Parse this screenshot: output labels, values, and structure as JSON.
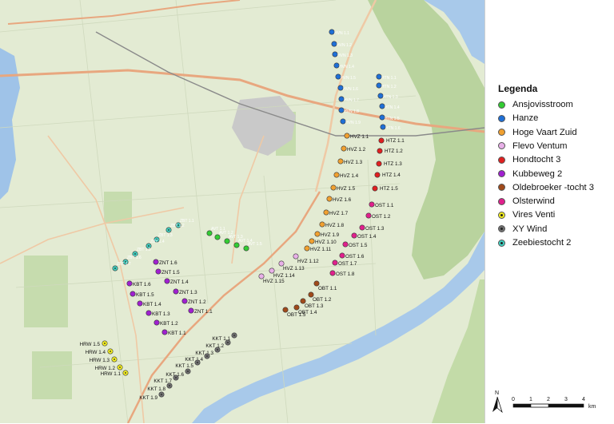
{
  "legend": {
    "title": "Legenda",
    "items": [
      {
        "label": "Ansjovisstroom",
        "color": "#33cc33",
        "center": false
      },
      {
        "label": "Hanze",
        "color": "#1f6fd6",
        "center": false
      },
      {
        "label": "Hoge Vaart Zuid",
        "color": "#f0a030",
        "center": false
      },
      {
        "label": "Flevo Ventum",
        "color": "#e8b0e8",
        "center": false
      },
      {
        "label": "Hondtocht 3",
        "color": "#e02020",
        "center": false
      },
      {
        "label": "Kubbeweg 2",
        "color": "#a020d0",
        "center": false
      },
      {
        "label": "Oldebroeker -tocht 3",
        "color": "#a04a1a",
        "center": false
      },
      {
        "label": "Olsterwind",
        "color": "#e0208c",
        "center": false
      },
      {
        "label": "Vires Venti",
        "color": "#f5f020",
        "center": true
      },
      {
        "label": "XY Wind",
        "color": "#707070",
        "center": true
      },
      {
        "label": "Zeebiestocht 2",
        "color": "#40d0c0",
        "center": true
      }
    ]
  },
  "scale": {
    "ticks": [
      "0",
      "1",
      "2",
      "3",
      "4"
    ],
    "unit": "km",
    "north": "N"
  },
  "turbines": [
    {
      "group": "Hanze",
      "color": "#1f6fd6",
      "center": false,
      "labelcolor": "#ffffff",
      "labels": [
        "HVN 1.1",
        "HVN 1.2",
        "HVN 1.3",
        "HVN 1.4",
        "HVN 1.5",
        "HVN 1.6",
        "HVN 1.7",
        "HVN 1.8",
        "HVN 1.9",
        "HTN 1.1",
        "HTN 1.2",
        "HTN 1.3",
        "HTN 1.4",
        "HTN 1.5",
        "HTN 1.6"
      ]
    },
    {
      "group": "Hondtocht 3",
      "color": "#e02020",
      "center": false,
      "labelcolor": "#111111",
      "labels": [
        "HTZ 1.1",
        "HTZ 1.2",
        "HTZ 1.3",
        "HTZ 1.4",
        "HTZ 1.5"
      ]
    },
    {
      "group": "Hoge Vaart Zuid",
      "color": "#f0a030",
      "center": false,
      "labelcolor": "#111111",
      "labels": [
        "HVZ 1.1",
        "HVZ 1.2",
        "HVZ 1.3",
        "HVZ 1.4",
        "HVZ 1.5",
        "HVZ 1.6",
        "HVZ 1.7",
        "HVZ 1.8",
        "HVZ 1.9",
        "HVZ 1.10",
        "HVZ 1.11"
      ]
    },
    {
      "group": "Flevo Ventum",
      "color": "#e8b0e8",
      "center": false,
      "labelcolor": "#111111",
      "labels": [
        "HVZ 1.12",
        "HVZ 1.13",
        "HVZ 1.14",
        "HVZ 1.15"
      ]
    },
    {
      "group": "Olsterwind",
      "color": "#e0208c",
      "center": false,
      "labelcolor": "#111111",
      "labels": [
        "OST 1.1",
        "OST 1.2",
        "OST 1.3",
        "OST 1.4",
        "OST 1.5",
        "OST 1.6",
        "OST 1.7",
        "OST 1.8"
      ]
    },
    {
      "group": "Oldebroeker -tocht 3",
      "color": "#a04a1a",
      "center": false,
      "labelcolor": "#111111",
      "labels": [
        "OBT 1.1",
        "OBT 1.2",
        "OBT 1.3",
        "OBT 1.4",
        "OBT 1.5"
      ]
    },
    {
      "group": "Ansjovisstroom",
      "color": "#33cc33",
      "center": false,
      "labelcolor": "#ffffff",
      "labels": [
        "AVT 1.1",
        "AVT 1.2",
        "AVT 1.3",
        "AVT 1.4",
        "AVT 1.5"
      ]
    },
    {
      "group": "Zeebiestocht 2",
      "color": "#40d0c0",
      "center": true,
      "labelcolor": "#ffffff",
      "labels": [
        "ZBT 1.1",
        "ZBT 1.2",
        "ZBT 1.3",
        "ZBT 1.4",
        "ZBT 1.5",
        "ZBT 1.6",
        "ZBT 1.7"
      ]
    },
    {
      "group": "Kubbeweg 2",
      "color": "#a020d0",
      "center": false,
      "labelcolor": "#111111",
      "labels": [
        "ZNT 1.6",
        "ZNT 1.5",
        "ZNT 1.4",
        "ZNT 1.3",
        "ZNT 1.2",
        "ZNT 1.1",
        "KBT 1.6",
        "KBT 1.5",
        "KBT 1.4",
        "KBT 1.3",
        "KBT 1.2",
        "KBT 1.1"
      ]
    },
    {
      "group": "XY Wind",
      "color": "#707070",
      "center": true,
      "labelcolor": "#111111",
      "labels": [
        "KKT 1.1",
        "KKT 1.2",
        "KKT 1.3",
        "KKT 1.4",
        "KKT 1.5",
        "KKT 1.6",
        "KKT 1.7",
        "KKT 1.8",
        "KKT 1.9"
      ]
    },
    {
      "group": "Vires Venti",
      "color": "#f5f020",
      "center": true,
      "labelcolor": "#111111",
      "labels": [
        "HRW 1.5",
        "HRW 1.4",
        "HRW 1.3",
        "HRW 1.2",
        "HRW 1.1"
      ]
    }
  ]
}
